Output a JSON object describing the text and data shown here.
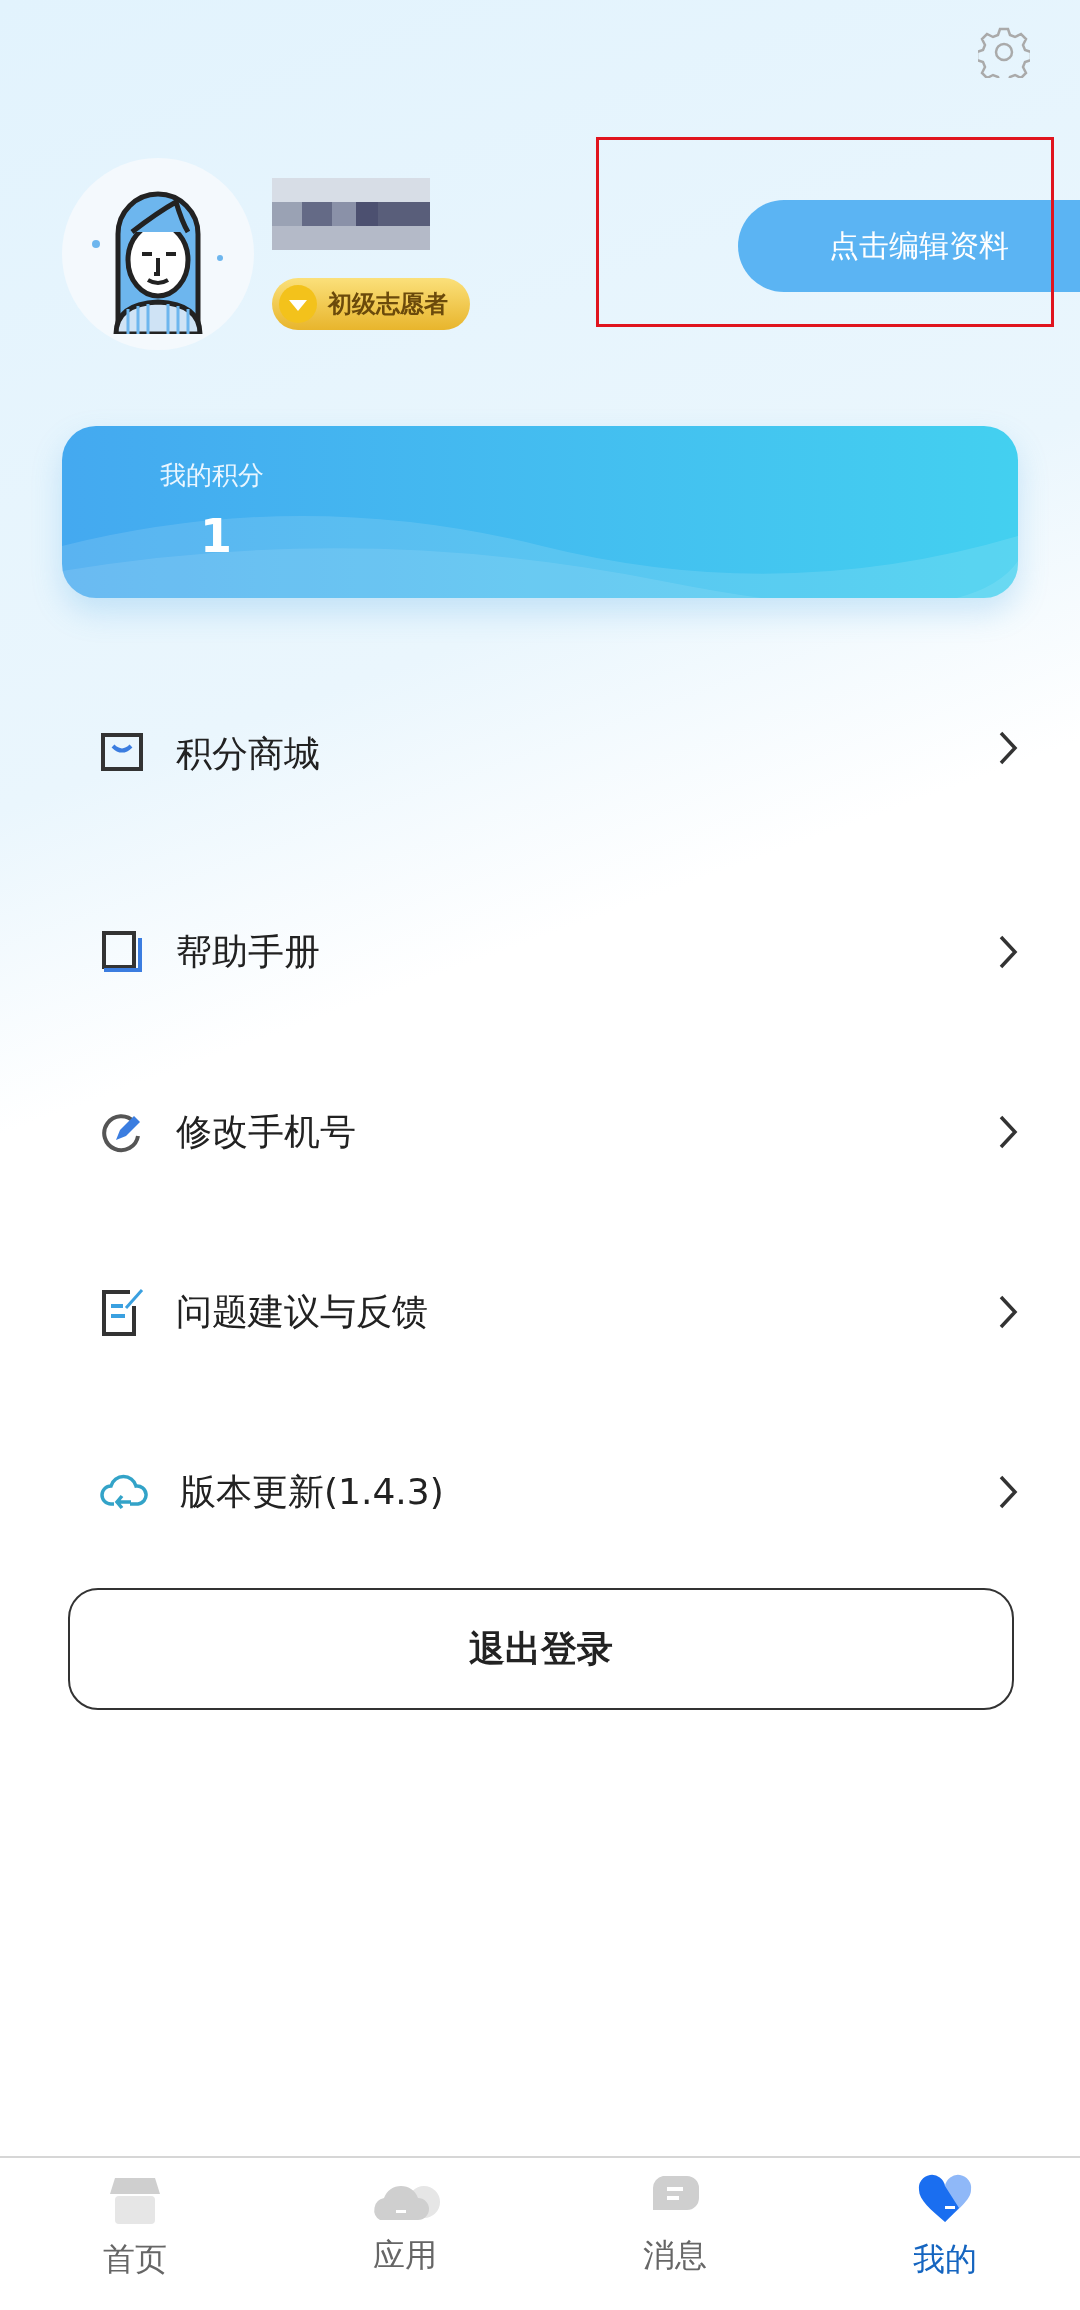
{
  "profile": {
    "badge": "初级志愿者",
    "edit_button": {
      "label": "点击编辑资料",
      "highlighted": true
    }
  },
  "points": {
    "label": "我的积分",
    "value": "1"
  },
  "menu": [
    {
      "kind": "shop",
      "label": "积分商城"
    },
    {
      "kind": "book",
      "label": "帮助手册"
    },
    {
      "kind": "edit",
      "label": "修改手机号"
    },
    {
      "kind": "feedback",
      "label": "问题建议与反馈"
    },
    {
      "kind": "update",
      "label": "版本更新(1.4.3)"
    }
  ],
  "logout": "退出登录",
  "tabs": [
    {
      "kind": "home",
      "label": "首页",
      "selected": false
    },
    {
      "kind": "apps",
      "label": "应用",
      "selected": false
    },
    {
      "kind": "messages",
      "label": "消息",
      "selected": false
    },
    {
      "kind": "me",
      "label": "我的",
      "selected": true
    }
  ]
}
